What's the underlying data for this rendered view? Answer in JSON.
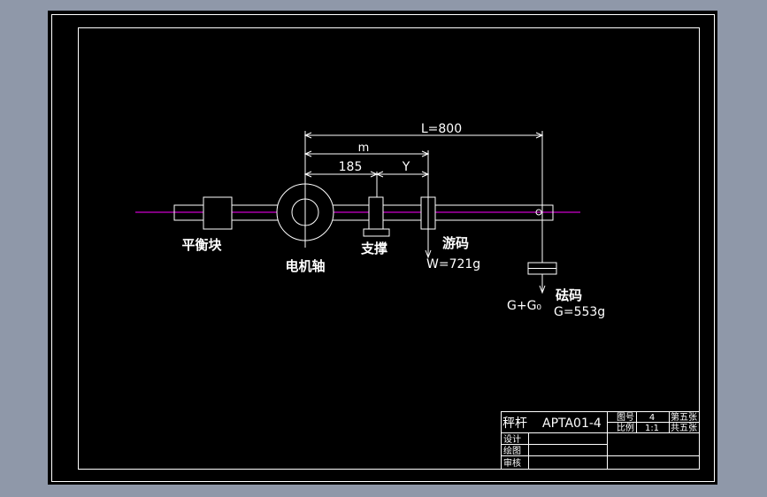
{
  "dimensions": {
    "total_length": "L=800",
    "m_label": "m",
    "support_offset": "185",
    "y_label": "Y"
  },
  "labels": {
    "counterweight": "平衡块",
    "motor_shaft": "电机轴",
    "support": "支撑",
    "rider_weight": "游码",
    "rider_weight_value": "W=721g",
    "weight_sum": "G+G₀",
    "weight": "砝码",
    "weight_value": "G=553g"
  },
  "title_block": {
    "part_name": "秤杆",
    "drawing_no": "APTA01-4",
    "fig_no_label": "图号",
    "fig_no_value": "4",
    "sheet_label": "第五张",
    "scale_label": "比例",
    "scale_value": "1:1",
    "total_sheets_label": "共五张",
    "design_label": "设计",
    "drawn_label": "绘图",
    "review_label": "审核"
  },
  "colors": {
    "background_outer": "#8f98a9",
    "sheet": "#000000",
    "lines": "#ffffff",
    "centerline": "#ff00ff"
  }
}
